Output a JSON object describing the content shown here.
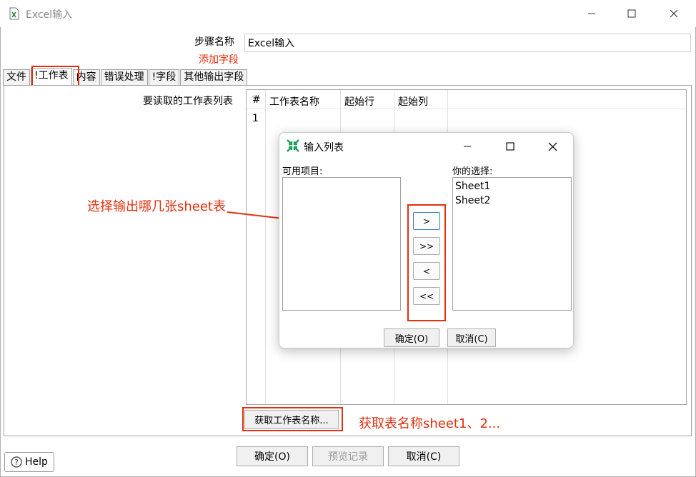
{
  "window": {
    "title": "Excel输入"
  },
  "step_name": {
    "label": "步骤名称",
    "value": "Excel输入"
  },
  "annotations": {
    "add_field": "添加字段",
    "select_sheets": "选择输出哪几张sheet表",
    "get_sheet_names": "获取表名称sheet1、2..."
  },
  "tabs": [
    {
      "label": "文件"
    },
    {
      "label": "!工作表"
    },
    {
      "label": "内容"
    },
    {
      "label": "错误处理"
    },
    {
      "label": "!字段"
    },
    {
      "label": "其他输出字段"
    }
  ],
  "sheets_panel": {
    "label": "要读取的工作表列表",
    "columns": [
      "#",
      "工作表名称",
      "起始行",
      "起始列"
    ],
    "rows": [
      {
        "num": "1"
      }
    ],
    "get_sheets_button": "获取工作表名称..."
  },
  "dialog": {
    "title": "输入列表",
    "available_label": "可用项目:",
    "chosen_label": "你的选择:",
    "chosen_items": [
      "Sheet1",
      "Sheet2"
    ],
    "move_buttons": [
      ">",
      ">>",
      "<",
      "<<"
    ],
    "ok": "确定(O)",
    "cancel": "取消(C)"
  },
  "footer": {
    "help": "Help",
    "ok": "确定(O)",
    "preview": "预览记录",
    "cancel": "取消(C)"
  },
  "colors": {
    "annotation": "#e03010",
    "dialog_icon": "#1e9e5a"
  }
}
